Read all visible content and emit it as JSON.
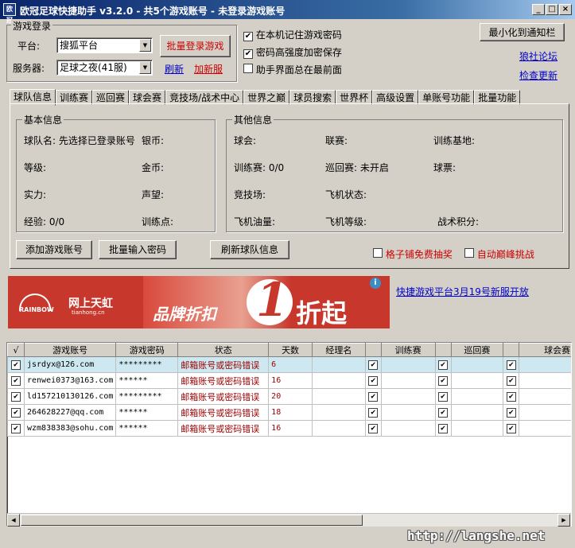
{
  "window": {
    "title": "欧冠足球快捷助手 v3.2.0 - 共5个游戏账号 - 未登录游戏账号",
    "icon_text": "欧冠",
    "buttons": {
      "minimize": "_",
      "maximize": "□",
      "close": "×"
    }
  },
  "login": {
    "group_title": "游戏登录",
    "platform_label": "平台:",
    "platform_value": "搜狐平台",
    "server_label": "服务器:",
    "server_value": "足球之夜(41服)",
    "batch_login": "批量登录游戏",
    "refresh": "刷新",
    "add_server": "加新服"
  },
  "options": {
    "remember_password": {
      "label": "在本机记住游戏密码",
      "checked": true
    },
    "encrypt_password": {
      "label": "密码高强度加密保存",
      "checked": true
    },
    "always_on_top": {
      "label": "助手界面总在最前面",
      "checked": false
    }
  },
  "right": {
    "minimize_tray": "最小化到通知栏",
    "forum": "狼社论坛",
    "check_update": "检查更新"
  },
  "tabs": [
    {
      "label": "球队信息",
      "active": true
    },
    {
      "label": "训练赛",
      "active": false
    },
    {
      "label": "巡回赛",
      "active": false
    },
    {
      "label": "球会赛",
      "active": false
    },
    {
      "label": "竞技场/战术中心",
      "active": false
    },
    {
      "label": "世界之巅",
      "active": false
    },
    {
      "label": "球员搜索",
      "active": false
    },
    {
      "label": "世界杯",
      "active": false
    },
    {
      "label": "高级设置",
      "active": false
    },
    {
      "label": "单账号功能",
      "active": false
    },
    {
      "label": "批量功能",
      "active": false
    }
  ],
  "basic": {
    "title": "基本信息",
    "team_name": "球队名: 先选择已登录账号",
    "silver": "银币:",
    "level": "等级:",
    "gold": "金币:",
    "strength": "实力:",
    "prestige": "声望:",
    "exp": "经验: 0/0",
    "training_points": "训练点:"
  },
  "other": {
    "title": "其他信息",
    "club": "球会:",
    "league": "联赛:",
    "training_base": "训练基地:",
    "training_match": "训练赛: 0/0",
    "tour": "巡回赛: 未开启",
    "tickets": "球票:",
    "arena": "竞技场:",
    "plane_status": "飞机状态:",
    "plane_fuel": "飞机油量:",
    "plane_level": "飞机等级:",
    "tactic_points": "战术积分:"
  },
  "actions": {
    "add_account": "添加游戏账号",
    "batch_password": "批量输入密码",
    "refresh_team": "刷新球队信息",
    "free_lottery": {
      "label": "格子铺免费抽奖",
      "checked": false
    },
    "auto_peak": {
      "label": "自动巅峰挑战",
      "checked": false
    }
  },
  "ad": {
    "brand": "网上天虹",
    "brand_sub": "RAINBOW",
    "brand_url": "tianhong.cn",
    "slogan": "品牌折扣",
    "number": "1",
    "suffix": "折起",
    "info": "i",
    "news_link": "快捷游戏平台3月19号新服开放"
  },
  "table": {
    "columns": [
      "√",
      "游戏账号",
      "游戏密码",
      "状态",
      "天数",
      "经理名",
      "",
      "训练赛",
      "",
      "巡回赛",
      "",
      "球会赛"
    ],
    "rows": [
      {
        "checked": true,
        "account": "jsrdyx@126.com",
        "password": "*********",
        "status": "邮箱账号或密码错误",
        "days": "6",
        "selected": true
      },
      {
        "checked": true,
        "account": "renwei0373@163.com",
        "password": "******",
        "status": "邮箱账号或密码错误",
        "days": "16",
        "selected": false
      },
      {
        "checked": true,
        "account": "ld157210130126.com",
        "password": "*********",
        "status": "邮箱账号或密码错误",
        "days": "20",
        "selected": false
      },
      {
        "checked": true,
        "account": "264628227@qq.com",
        "password": "******",
        "status": "邮箱账号或密码错误",
        "days": "18",
        "selected": false
      },
      {
        "checked": true,
        "account": "wzm838383@sohu.com",
        "password": "******",
        "status": "邮箱账号或密码错误",
        "days": "16",
        "selected": false
      }
    ]
  },
  "watermark": "http://langshe.net",
  "colors": {
    "titlebar": "#0a246a",
    "error": "#990000",
    "link": "#0000cc",
    "selected_row": "#cde8f0"
  }
}
